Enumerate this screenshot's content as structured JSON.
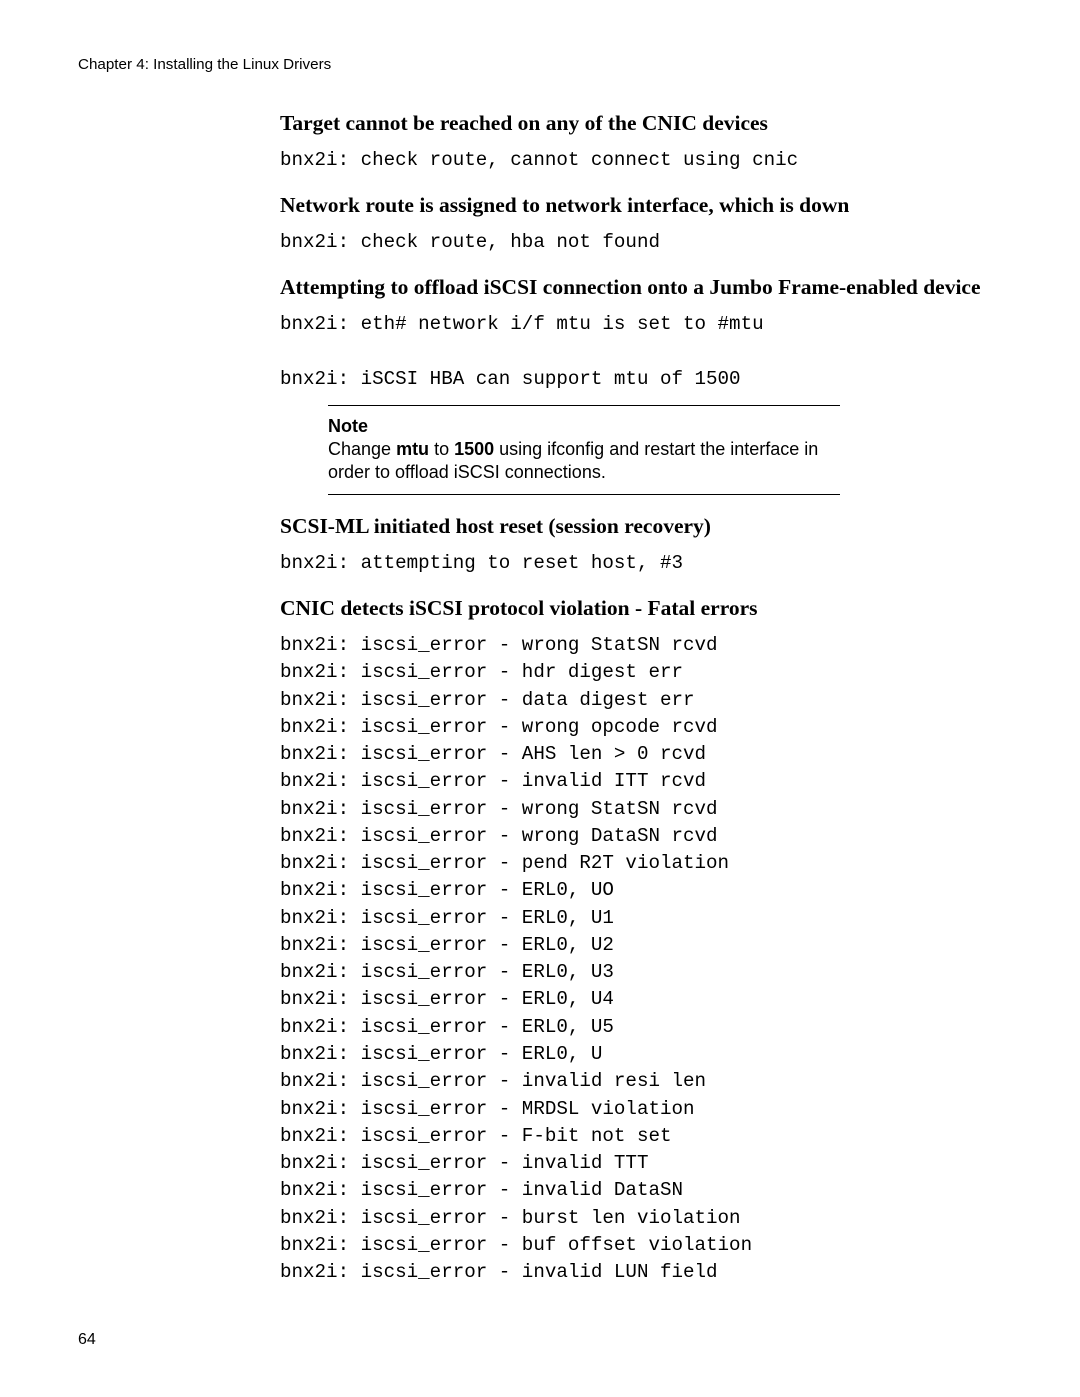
{
  "header": {
    "chapter": "Chapter 4: Installing the Linux Drivers"
  },
  "sections": {
    "s1": {
      "heading": "Target cannot be reached on any of the CNIC devices",
      "code": "bnx2i: check route, cannot connect using cnic"
    },
    "s2": {
      "heading": "Network route is assigned to network interface, which is down",
      "code": "bnx2i: check route, hba not found"
    },
    "s3": {
      "heading": "Attempting to offload iSCSI connection onto a Jumbo Frame-enabled device",
      "code": "bnx2i: eth# network i/f mtu is set to #mtu\n\nbnx2i: iSCSI HBA can support mtu of 1500"
    },
    "note": {
      "label": "Note",
      "pre": "Change ",
      "b1": "mtu",
      "mid": " to ",
      "b2": "1500",
      "post": " using ifconfig and restart the interface in order to offload iSCSI connections."
    },
    "s4": {
      "heading": "SCSI-ML initiated host reset (session recovery)",
      "code": "bnx2i: attempting to reset host, #3"
    },
    "s5": {
      "heading": "CNIC detects iSCSI protocol violation - Fatal errors",
      "code": "bnx2i: iscsi_error - wrong StatSN rcvd\nbnx2i: iscsi_error - hdr digest err\nbnx2i: iscsi_error - data digest err\nbnx2i: iscsi_error - wrong opcode rcvd\nbnx2i: iscsi_error - AHS len > 0 rcvd\nbnx2i: iscsi_error - invalid ITT rcvd\nbnx2i: iscsi_error - wrong StatSN rcvd\nbnx2i: iscsi_error - wrong DataSN rcvd\nbnx2i: iscsi_error - pend R2T violation\nbnx2i: iscsi_error - ERL0, UO\nbnx2i: iscsi_error - ERL0, U1\nbnx2i: iscsi_error - ERL0, U2\nbnx2i: iscsi_error - ERL0, U3\nbnx2i: iscsi_error - ERL0, U4\nbnx2i: iscsi_error - ERL0, U5\nbnx2i: iscsi_error - ERL0, U\nbnx2i: iscsi_error - invalid resi len\nbnx2i: iscsi_error - MRDSL violation\nbnx2i: iscsi_error - F-bit not set\nbnx2i: iscsi_error - invalid TTT\nbnx2i: iscsi_error - invalid DataSN\nbnx2i: iscsi_error - burst len violation\nbnx2i: iscsi_error - buf offset violation\nbnx2i: iscsi_error - invalid LUN field"
    }
  },
  "footer": {
    "page_number": "64"
  }
}
